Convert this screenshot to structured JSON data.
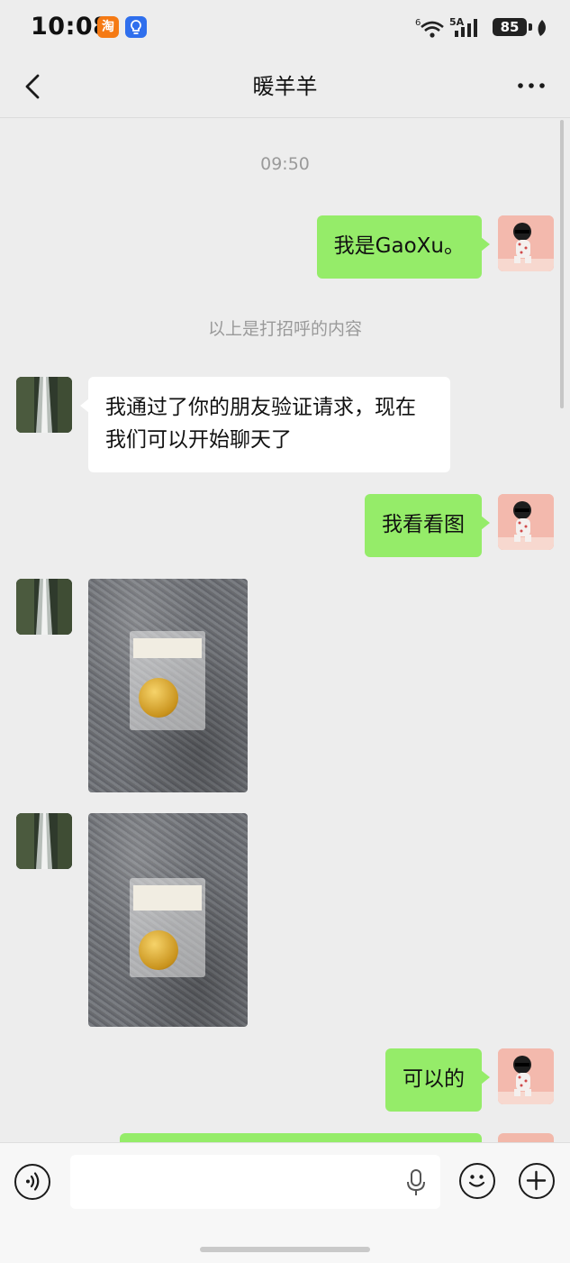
{
  "status_bar": {
    "time": "10:08",
    "taobao_badge": "淘",
    "network_badge": "6",
    "network_type": "5A",
    "battery": "85"
  },
  "nav": {
    "title": "暖羊羊"
  },
  "messages": [
    {
      "type": "timestamp",
      "text": "09:50"
    },
    {
      "type": "self",
      "text": "我是GaoXu。"
    },
    {
      "type": "system",
      "text": "以上是打招呼的内容"
    },
    {
      "type": "other",
      "text": "我通过了你的朋友验证请求，现在我们可以开始聊天了"
    },
    {
      "type": "self",
      "text": "我看看图"
    },
    {
      "type": "other-image",
      "label": "photo of gold coin in plastic holder"
    },
    {
      "type": "other-image",
      "label": "photo of gold coin in plastic holder"
    },
    {
      "type": "self",
      "text": "可以的"
    }
  ],
  "input": {
    "placeholder": ""
  },
  "colors": {
    "chat_background": "#ededed",
    "self_bubble": "#95ec69",
    "other_bubble": "#ffffff",
    "timestamp_text": "#9a9a9a"
  }
}
